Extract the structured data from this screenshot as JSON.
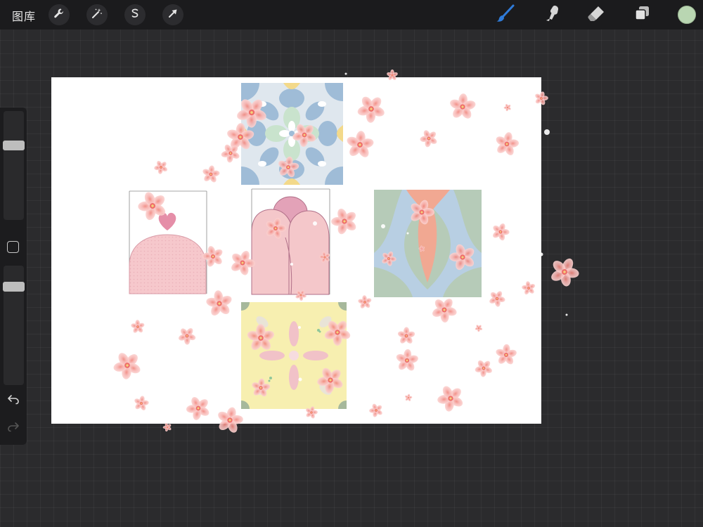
{
  "toolbar": {
    "gallery_label": "图库",
    "left_tools": [
      "wrench-icon",
      "magic-wand-icon",
      "selection-icon",
      "transform-arrow-icon"
    ],
    "right_tools": [
      "brush-icon",
      "smudge-icon",
      "eraser-icon",
      "layers-icon"
    ],
    "active_tool": "brush-icon",
    "active_tool_color": "#2f7bd9",
    "current_color": "#b9d6b2"
  },
  "sidebar": {
    "brush_size_level": 0.7,
    "opacity_level": 0.85
  },
  "canvas": {
    "background": "#ffffff",
    "petal_color": "#f4a6a4",
    "tiles": [
      {
        "name": "blue-floral-tile",
        "colors": [
          "#dfe7ee",
          "#9fbcd7",
          "#c9e3cd",
          "#f3d98a"
        ]
      },
      {
        "name": "pink-heart-arch-sketch",
        "colors": [
          "#f6c8cc",
          "#e58ea8"
        ]
      },
      {
        "name": "pink-fingers-sketch",
        "colors": [
          "#f4c7ca",
          "#e3a2b8"
        ]
      },
      {
        "name": "blue-green-pink-tile",
        "colors": [
          "#b8cfe3",
          "#b6cbb8",
          "#f1a892"
        ]
      },
      {
        "name": "yellow-flower-tile",
        "colors": [
          "#f7efb0",
          "#f1c2c8",
          "#8fc79a"
        ]
      }
    ]
  }
}
